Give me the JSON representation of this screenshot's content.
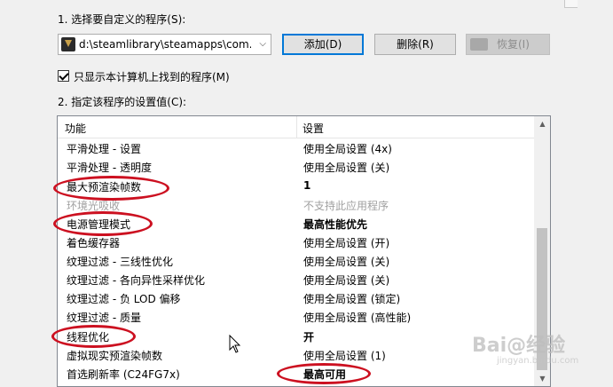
{
  "section1": {
    "label": "1. 选择要自定义的程序(S):"
  },
  "program_select": {
    "value": "d:\\steamlibrary\\steamapps\\com...",
    "icon": "game-program-icon"
  },
  "buttons": {
    "add": "添加(D)",
    "remove": "删除(R)",
    "restore": "恢复(I)"
  },
  "filter_checkbox": {
    "label": "只显示本计算机上找到的程序(M)",
    "checked": true
  },
  "section2": {
    "label": "2. 指定该程序的设置值(C):"
  },
  "grid": {
    "col_feature": "功能",
    "col_setting": "设置",
    "rows": [
      {
        "feature": "平滑处理 - 设置",
        "setting": "使用全局设置 (4x)"
      },
      {
        "feature": "平滑处理 - 透明度",
        "setting": "使用全局设置 (关)"
      },
      {
        "feature": "最大预渲染帧数",
        "setting": "1"
      },
      {
        "feature": "环境光吸收",
        "setting": "不支持此应用程序"
      },
      {
        "feature": "电源管理模式",
        "setting": "最高性能优先"
      },
      {
        "feature": "着色缓存器",
        "setting": "使用全局设置 (开)"
      },
      {
        "feature": "纹理过滤 - 三线性优化",
        "setting": "使用全局设置 (关)"
      },
      {
        "feature": "纹理过滤 - 各向异性采样优化",
        "setting": "使用全局设置 (关)"
      },
      {
        "feature": "纹理过滤 - 负 LOD 偏移",
        "setting": "使用全局设置 (锁定)"
      },
      {
        "feature": "纹理过滤 - 质量",
        "setting": "使用全局设置 (高性能)"
      },
      {
        "feature": "线程优化",
        "setting": "开"
      },
      {
        "feature": "虚拟现实预渲染帧数",
        "setting": "使用全局设置 (1)"
      },
      {
        "feature": "首选刷新率 (C24FG7x)",
        "setting": "最高可用"
      }
    ]
  },
  "watermark": {
    "brand": "Bai@经验",
    "url": "jingyan.baidu.com"
  },
  "colors": {
    "highlight_oval": "#cc1020",
    "accent": "#0078d7"
  }
}
